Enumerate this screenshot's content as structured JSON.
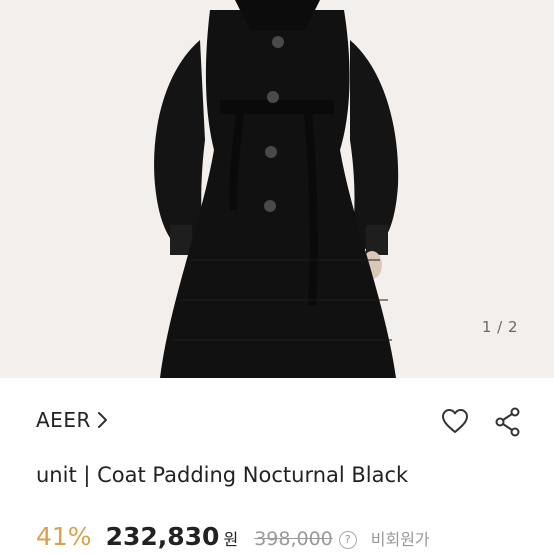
{
  "product_image": {
    "counter": "1 / 2"
  },
  "brand": {
    "name": "AEER"
  },
  "icons": {
    "brand_chevron": "chevron-right-icon",
    "wishlist": "heart-icon",
    "share": "share-icon",
    "help": "question-circle-icon"
  },
  "product": {
    "title": "unit | Coat Padding Nocturnal Black"
  },
  "price": {
    "discount": "41%",
    "sale_price": "232,830",
    "currency": "원",
    "original_price": "398,000",
    "help_glyph": "?",
    "retail_label": "비회원가"
  },
  "colors": {
    "discount": "#d8a24d",
    "background": "#ffffff",
    "photo_background": "#f3efec"
  }
}
